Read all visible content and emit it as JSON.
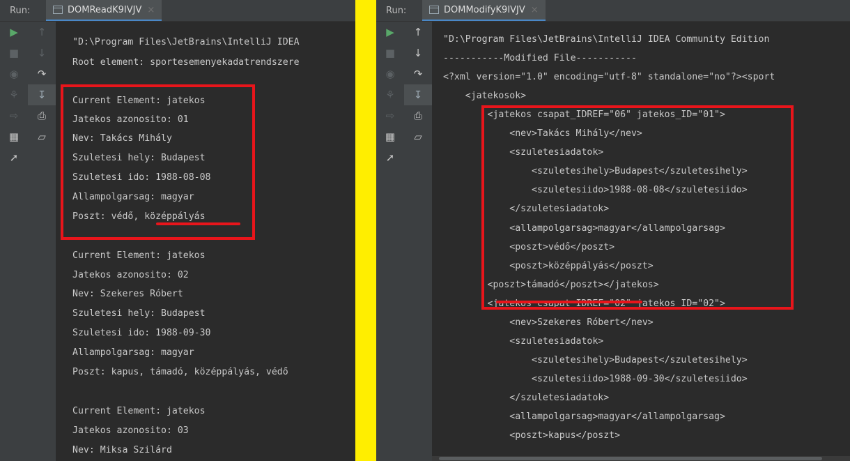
{
  "left": {
    "run_label": "Run:",
    "tab_title": "DOMReadK9IVJV",
    "tab_close": "×",
    "lines": [
      "\"D:\\Program Files\\JetBrains\\IntelliJ IDEA",
      "Root element: sportesemenyekadatrendszere",
      "",
      "Current Element: jatekos",
      "Jatekos azonosito: 01",
      "Nev: Takács Mihály",
      "Szuletesi hely: Budapest",
      "Szuletesi ido: 1988-08-08",
      "Allampolgarsag: magyar",
      "Poszt: védő, középpályás",
      "",
      "Current Element: jatekos",
      "Jatekos azonosito: 02",
      "Nev: Szekeres Róbert",
      "Szuletesi hely: Budapest",
      "Szuletesi ido: 1988-09-30",
      "Allampolgarsag: magyar",
      "Poszt: kapus, támadó, középpályás, védő",
      "",
      "Current Element: jatekos",
      "Jatekos azonosito: 03",
      "Nev: Miksa Szilárd"
    ]
  },
  "right": {
    "run_label": "Run:",
    "tab_title": "DOMModifyK9IVJV",
    "tab_close": "×",
    "lines": [
      "\"D:\\Program Files\\JetBrains\\IntelliJ IDEA Community Edition",
      "-----------Modified File-----------",
      "<?xml version=\"1.0\" encoding=\"utf-8\" standalone=\"no\"?><sport",
      "    <jatekosok>",
      "        <jatekos csapat_IDREF=\"06\" jatekos_ID=\"01\">",
      "            <nev>Takács Mihály</nev>",
      "            <szuletesiadatok>",
      "                <szuletesihely>Budapest</szuletesihely>",
      "                <szuletesiido>1988-08-08</szuletesiido>",
      "            </szuletesiadatok>",
      "            <allampolgarsag>magyar</allampolgarsag>",
      "            <poszt>védő</poszt>",
      "            <poszt>középpályás</poszt>",
      "        <poszt>támadó</poszt></jatekos>",
      "        <jatekos csapat_IDREF=\"02\" jatekos_ID=\"02\">",
      "            <nev>Szekeres Róbert</nev>",
      "            <szuletesiadatok>",
      "                <szuletesihely>Budapest</szuletesihely>",
      "                <szuletesiido>1988-09-30</szuletesiido>",
      "            </szuletesiadatok>",
      "            <allampolgarsag>magyar</allampolgarsag>",
      "            <poszt>kapus</poszt>"
    ]
  },
  "toolbar_icons": {
    "outer": [
      "run-icon",
      "stop-icon",
      "camera-icon",
      "debug-bug-icon",
      "login-icon",
      "layout-icon",
      "pin-icon"
    ],
    "inner": [
      "arrow-up-icon",
      "arrow-down-icon",
      "soft-wrap-icon",
      "scroll-to-end-icon",
      "print-icon",
      "trash-icon"
    ]
  },
  "colors": {
    "highlight": "#e8151b",
    "divider": "#ffee00",
    "console_bg": "#2b2b2b"
  }
}
